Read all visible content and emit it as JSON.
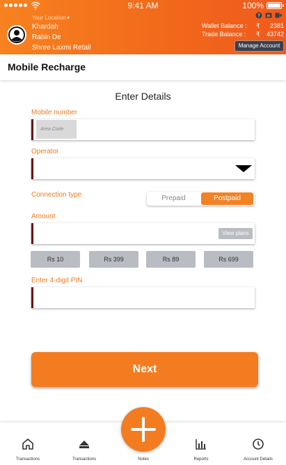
{
  "status_bar": {
    "time": "9:41 AM",
    "battery": "100%"
  },
  "header": {
    "location_label": "Your Location",
    "location": "Khardah",
    "user_name": "Rabin De",
    "shop_name": "Shree Laxmi Retail",
    "wallet_label": "Wallet Balance :",
    "wallet_currency": "₹",
    "wallet_amount": "2381",
    "trade_label": "Trade Balance :",
    "trade_currency": "₹",
    "trade_amount": "43742",
    "manage_account": "Manage Account"
  },
  "page": {
    "title": "Mobile Recharge",
    "section_title": "Enter Details"
  },
  "form": {
    "mobile_label": "Mobile number",
    "area_code_placeholder": "Area Code",
    "operator_label": "Operator",
    "connection_label": "Connection type",
    "connection_options": [
      "Prepaid",
      "Postpaid"
    ],
    "connection_selected": "Postpaid",
    "amount_label": "Amount",
    "view_plans": "View plans",
    "amount_chips": [
      "Rs 10",
      "Rs 399",
      "Rs 89",
      "Rs 699"
    ],
    "pin_label": "Enter 4-digit PIN",
    "next": "Next"
  },
  "nav": {
    "items": [
      {
        "label": "Transactions",
        "icon": "home-icon"
      },
      {
        "label": "Transactions",
        "icon": "cash-icon"
      },
      {
        "label": "Notes",
        "icon": "plus-icon"
      },
      {
        "label": "Reports",
        "icon": "bar-chart-icon"
      },
      {
        "label": "Account Details",
        "icon": "clock-icon"
      }
    ]
  },
  "colors": {
    "accent": "#f47c20",
    "field_marker": "#6b1010",
    "chip": "#b9bcc2",
    "manage_button": "#3c3f4a"
  }
}
